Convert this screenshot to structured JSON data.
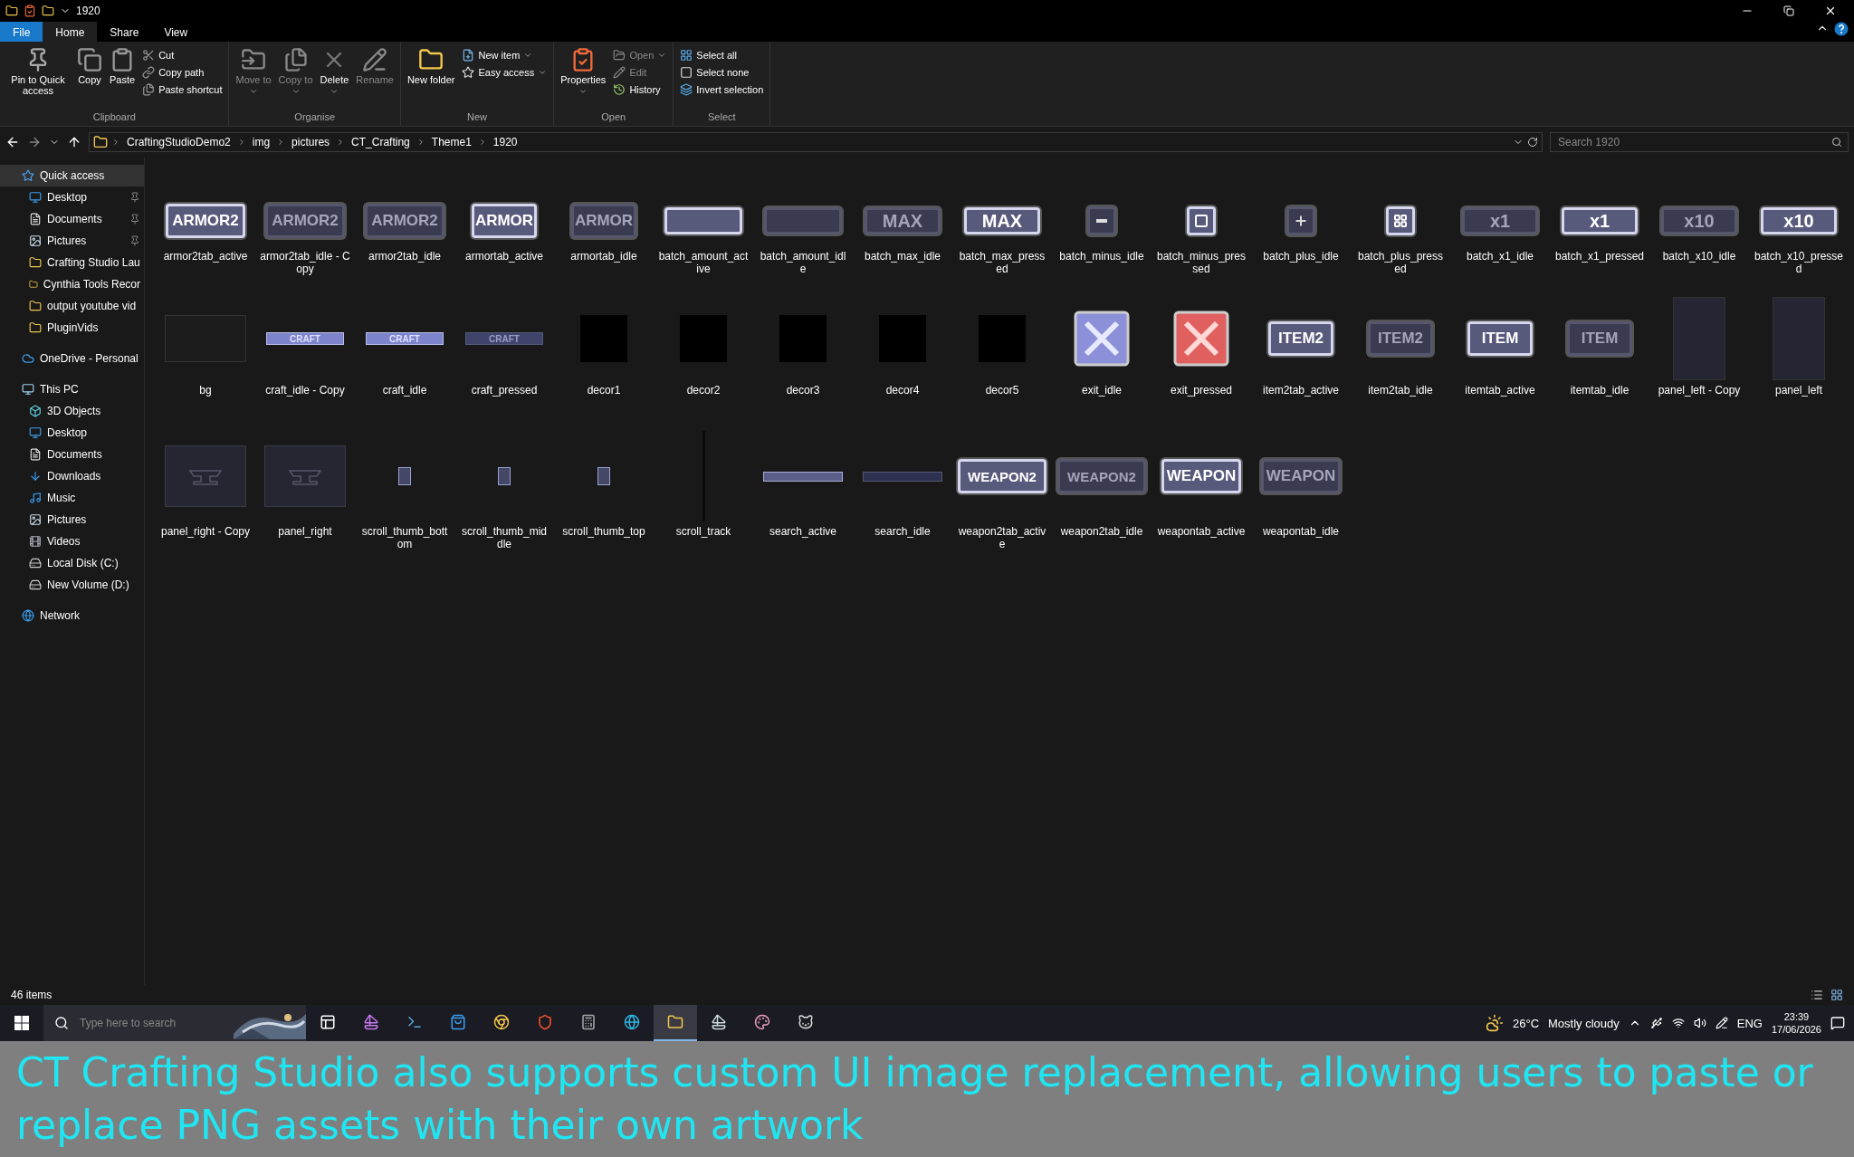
{
  "title_bar": {
    "title": "1920"
  },
  "ribbon_tabs": [
    {
      "label": "File",
      "kind": "file",
      "selected": false
    },
    {
      "label": "Home",
      "kind": "tab",
      "selected": true
    },
    {
      "label": "Share",
      "kind": "tab",
      "selected": false
    },
    {
      "label": "View",
      "kind": "tab",
      "selected": false
    }
  ],
  "ribbon_groups": [
    {
      "label": "Clipboard",
      "items": [
        {
          "kind": "large",
          "label": "Pin to Quick access",
          "disabled": false,
          "dropdown": false
        },
        {
          "kind": "large",
          "label": "Copy",
          "disabled": false,
          "dropdown": false
        },
        {
          "kind": "large",
          "label": "Paste",
          "disabled": false,
          "dropdown": false
        },
        {
          "kind": "stack",
          "items": [
            {
              "label": "Cut",
              "disabled": false,
              "dropdown": false
            },
            {
              "label": "Copy path",
              "disabled": false,
              "dropdown": false
            },
            {
              "label": "Paste shortcut",
              "disabled": false,
              "dropdown": false
            }
          ]
        }
      ]
    },
    {
      "label": "Organise",
      "items": [
        {
          "kind": "large",
          "label": "Move to",
          "disabled": true,
          "dropdown": true
        },
        {
          "kind": "large",
          "label": "Copy to",
          "disabled": true,
          "dropdown": true
        },
        {
          "kind": "large",
          "label": "Delete",
          "disabled": false,
          "dropdown": true
        },
        {
          "kind": "large",
          "label": "Rename",
          "disabled": true,
          "dropdown": false
        }
      ]
    },
    {
      "label": "New",
      "items": [
        {
          "kind": "large",
          "label": "New folder",
          "disabled": false,
          "dropdown": false
        },
        {
          "kind": "stack",
          "items": [
            {
              "label": "New item",
              "disabled": false,
              "dropdown": true
            },
            {
              "label": "Easy access",
              "disabled": false,
              "dropdown": true
            }
          ]
        }
      ]
    },
    {
      "label": "Open",
      "items": [
        {
          "kind": "large",
          "label": "Properties",
          "disabled": false,
          "dropdown": true
        },
        {
          "kind": "stack",
          "items": [
            {
              "label": "Open",
              "disabled": true,
              "dropdown": true
            },
            {
              "label": "Edit",
              "disabled": true,
              "dropdown": false
            },
            {
              "label": "History",
              "disabled": false,
              "dropdown": false
            }
          ]
        }
      ]
    },
    {
      "label": "Select",
      "items": [
        {
          "kind": "stack",
          "items": [
            {
              "label": "Select all",
              "disabled": false,
              "dropdown": false
            },
            {
              "label": "Select none",
              "disabled": false,
              "dropdown": false
            },
            {
              "label": "Invert selection",
              "disabled": false,
              "dropdown": false
            }
          ]
        }
      ]
    }
  ],
  "address_bar": {
    "path": [
      "CraftingStudioDemo2",
      "img",
      "pictures",
      "CT_Crafting",
      "Theme1",
      "1920"
    ],
    "search_placeholder": "Search 1920"
  },
  "sidebar": [
    {
      "label": "Quick access",
      "selected": true,
      "children": [
        {
          "label": "Desktop",
          "pinned": true,
          "selected": false
        },
        {
          "label": "Documents",
          "pinned": true,
          "selected": false
        },
        {
          "label": "Pictures",
          "pinned": true,
          "selected": false
        },
        {
          "label": "Crafting Studio Lau",
          "pinned": false,
          "selected": false
        },
        {
          "label": "Cynthia Tools Recor",
          "pinned": false,
          "selected": false
        },
        {
          "label": "output youtube vid",
          "pinned": false,
          "selected": false
        },
        {
          "label": "PluginVids",
          "pinned": false,
          "selected": false
        }
      ]
    },
    {
      "label": "OneDrive - Personal",
      "selected": false
    },
    {
      "label": "This PC",
      "selected": false,
      "children": [
        {
          "label": "3D Objects",
          "pinned": false,
          "selected": false
        },
        {
          "label": "Desktop",
          "pinned": false,
          "selected": false
        },
        {
          "label": "Documents",
          "pinned": false,
          "selected": false
        },
        {
          "label": "Downloads",
          "pinned": false,
          "selected": false
        },
        {
          "label": "Music",
          "pinned": false,
          "selected": false
        },
        {
          "label": "Pictures",
          "pinned": false,
          "selected": false
        },
        {
          "label": "Videos",
          "pinned": false,
          "selected": false
        },
        {
          "label": "Local Disk (C:)",
          "pinned": false,
          "selected": false
        },
        {
          "label": "New Volume (D:)",
          "pinned": false,
          "selected": false
        }
      ]
    },
    {
      "label": "Network",
      "selected": false
    }
  ],
  "files": [
    {
      "name": "armor2tab_active",
      "kind": "tab",
      "text": "ARMOR2",
      "active": true
    },
    {
      "name": "armor2tab_idle - Copy",
      "kind": "tab",
      "text": "ARMOR2",
      "active": false
    },
    {
      "name": "armor2tab_idle",
      "kind": "tab",
      "text": "ARMOR2",
      "active": false
    },
    {
      "name": "armortab_active",
      "kind": "tab",
      "text": "ARMOR",
      "active": true
    },
    {
      "name": "armortab_idle",
      "kind": "tab",
      "text": "ARMOR",
      "active": false
    },
    {
      "name": "batch_amount_active",
      "kind": "field",
      "active": true
    },
    {
      "name": "batch_amount_idle",
      "kind": "field",
      "active": false
    },
    {
      "name": "batch_max_idle",
      "kind": "wide",
      "text": "MAX",
      "active": false
    },
    {
      "name": "batch_max_pressed",
      "kind": "wide",
      "text": "MAX",
      "active": true
    },
    {
      "name": "batch_minus_idle",
      "kind": "small",
      "active": false
    },
    {
      "name": "batch_minus_pressed",
      "kind": "small",
      "active": true
    },
    {
      "name": "batch_plus_idle",
      "kind": "small",
      "active": false
    },
    {
      "name": "batch_plus_pressed",
      "kind": "small",
      "active": true
    },
    {
      "name": "batch_x1_idle",
      "kind": "wide",
      "text": "x1",
      "active": false
    },
    {
      "name": "batch_x1_pressed",
      "kind": "wide",
      "text": "x1",
      "active": true
    },
    {
      "name": "batch_x10_idle",
      "kind": "wide",
      "text": "x10",
      "active": false
    },
    {
      "name": "batch_x10_pressed",
      "kind": "wide",
      "text": "x10",
      "active": true
    },
    {
      "name": "bg",
      "kind": "frame"
    },
    {
      "name": "craft_idle - Copy",
      "kind": "strip",
      "text": "CRAFT",
      "active": true
    },
    {
      "name": "craft_idle",
      "kind": "strip",
      "text": "CRAFT",
      "active": true
    },
    {
      "name": "craft_pressed",
      "kind": "strip",
      "text": "CRAFT",
      "active": false
    },
    {
      "name": "decor1",
      "kind": "block"
    },
    {
      "name": "decor2",
      "kind": "block"
    },
    {
      "name": "decor3",
      "kind": "block"
    },
    {
      "name": "decor4",
      "kind": "block"
    },
    {
      "name": "decor5",
      "kind": "block"
    },
    {
      "name": "exit_idle",
      "kind": "exit",
      "active": false
    },
    {
      "name": "exit_pressed",
      "kind": "exit",
      "active": true
    },
    {
      "name": "item2tab_active",
      "kind": "tab",
      "text": "ITEM2",
      "active": true
    },
    {
      "name": "item2tab_idle",
      "kind": "tab",
      "text": "ITEM2",
      "active": false
    },
    {
      "name": "itemtab_active",
      "kind": "tab",
      "text": "ITEM",
      "active": true
    },
    {
      "name": "itemtab_idle",
      "kind": "tab",
      "text": "ITEM",
      "active": false
    },
    {
      "name": "panel_left - Copy",
      "kind": "panel"
    },
    {
      "name": "panel_left",
      "kind": "panel"
    },
    {
      "name": "panel_right - Copy",
      "kind": "anvil"
    },
    {
      "name": "panel_right",
      "kind": "anvil"
    },
    {
      "name": "scroll_thumb_bottom",
      "kind": "thumb"
    },
    {
      "name": "scroll_thumb_middle",
      "kind": "thumb"
    },
    {
      "name": "scroll_thumb_top",
      "kind": "thumb"
    },
    {
      "name": "scroll_track",
      "kind": "track"
    },
    {
      "name": "search_active",
      "kind": "bar",
      "active": true
    },
    {
      "name": "search_idle",
      "kind": "bar",
      "active": false
    },
    {
      "name": "weapon2tab_active",
      "kind": "tab",
      "text": "WEAPON2",
      "active": true
    },
    {
      "name": "weapon2tab_idle",
      "kind": "tab",
      "text": "WEAPON2",
      "active": false
    },
    {
      "name": "weapontab_active",
      "kind": "tab",
      "text": "WEAPON",
      "active": true
    },
    {
      "name": "weapontab_idle",
      "kind": "tab",
      "text": "WEAPON",
      "active": false
    }
  ],
  "status_bar": {
    "count": "46 items"
  },
  "taskbar": {
    "search_placeholder": "Type here to search",
    "apps": [
      {
        "selected": false
      },
      {
        "selected": false
      },
      {
        "selected": false
      },
      {
        "selected": false
      },
      {
        "selected": false
      },
      {
        "selected": false
      },
      {
        "selected": false
      },
      {
        "selected": false
      },
      {
        "selected": true
      },
      {
        "selected": false
      },
      {
        "selected": false
      },
      {
        "selected": false
      }
    ],
    "temperature": "26°C",
    "weather": "Mostly cloudy",
    "language": "ENG",
    "time": "23:39",
    "date": "17/06/2026"
  },
  "caption": "CT Crafting Studio also supports custom UI image replacement, allowing users to paste or replace PNG assets with their own artwork"
}
